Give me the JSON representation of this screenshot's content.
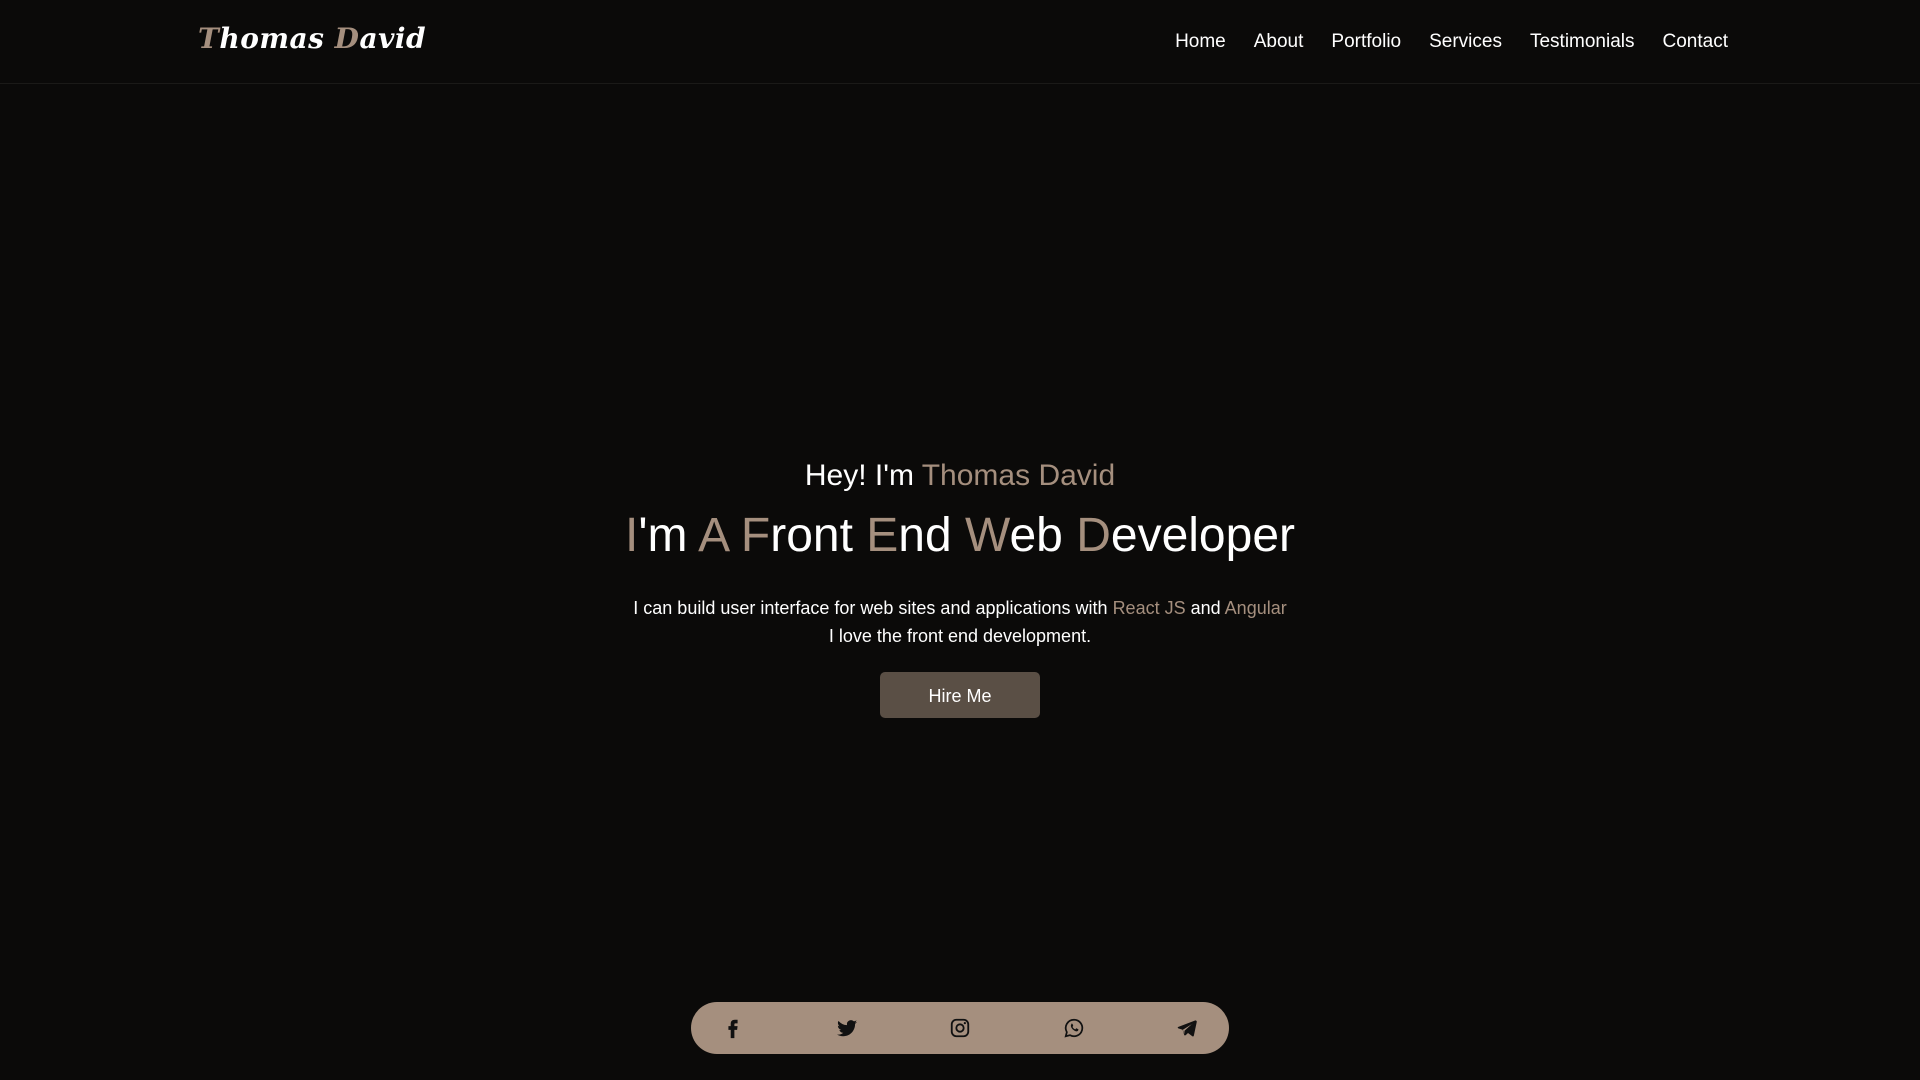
{
  "brand": {
    "first_initial": "T",
    "first_rest": "homas",
    "last_initial": "D",
    "last_rest": "avid"
  },
  "nav": {
    "items": [
      "Home",
      "About",
      "Portfolio",
      "Services",
      "Testimonials",
      "Contact"
    ]
  },
  "hero": {
    "greeting_prefix": "Hey! I'm",
    "greeting_name": "Thomas David",
    "role": {
      "w1_cap": "I",
      "w1_rest": "'m",
      "w2_cap": "A",
      "w3_cap": "F",
      "w3_rest": "ront",
      "w4_cap": "E",
      "w4_rest": "nd",
      "w5_cap": "W",
      "w5_rest": "eb",
      "w6_cap": "D",
      "w6_rest": "eveloper"
    },
    "description": {
      "line1_prefix": "I can build user interface for web sites and applications with",
      "tech1": "React JS",
      "conjunction": "and",
      "tech2": "Angular",
      "line2": "I love the front end development."
    },
    "hire_button": "Hire Me"
  },
  "social": {
    "icons": [
      "facebook-icon",
      "twitter-icon",
      "instagram-icon",
      "whatsapp-icon",
      "telegram-icon"
    ]
  },
  "colors": {
    "background": "#0b0a09",
    "accent": "#a58f7e",
    "button": "#5a4f45",
    "text": "#ffffff"
  }
}
